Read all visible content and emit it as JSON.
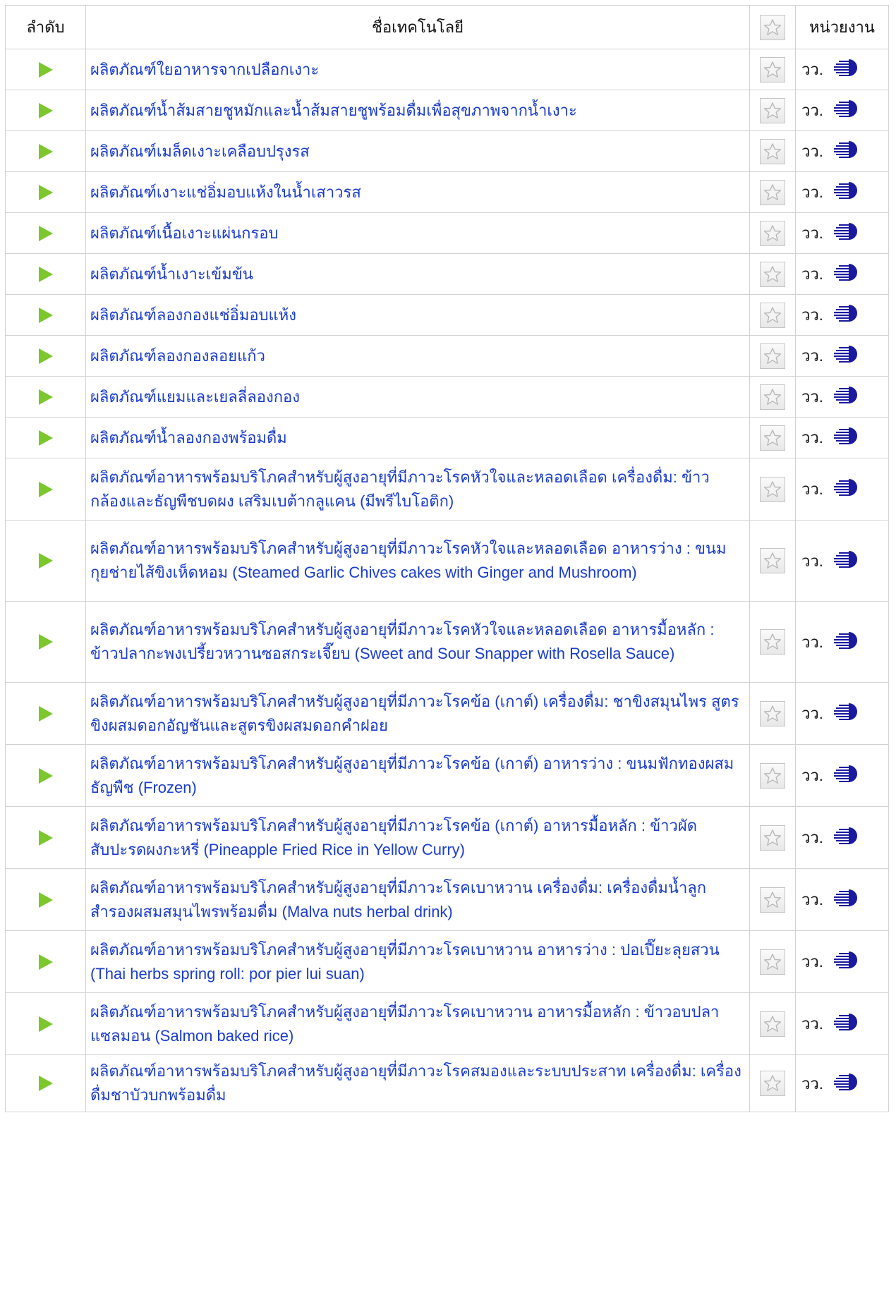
{
  "header": {
    "seq": "ลำดับ",
    "name": "ชื่อเทคโนโลยี",
    "fav_icon": "star-outline-icon",
    "unit": "หน่วยงาน"
  },
  "colors": {
    "link": "#1a3ccd",
    "play": "#7bc72c",
    "logo": "#1a1aa0",
    "border": "#d2d2d2"
  },
  "rows": [
    {
      "name": "ผลิตภัณฑ์ใยอาหารจากเปลือกเงาะ",
      "unit": "วว."
    },
    {
      "name": "ผลิตภัณฑ์น้ำส้มสายชูหมักและน้ำส้มสายชูพร้อมดื่มเพื่อสุขภาพจากน้ำเงาะ",
      "unit": "วว."
    },
    {
      "name": "ผลิตภัณฑ์เมล็ดเงาะเคลือบปรุงรส",
      "unit": "วว."
    },
    {
      "name": "ผลิตภัณฑ์เงาะแช่อิ่มอบแห้งในน้ำเสาวรส",
      "unit": "วว."
    },
    {
      "name": "ผลิตภัณฑ์เนื้อเงาะแผ่นกรอบ",
      "unit": "วว."
    },
    {
      "name": "ผลิตภัณฑ์น้ำเงาะเข้มข้น",
      "unit": "วว."
    },
    {
      "name": "ผลิตภัณฑ์ลองกองแช่อิ่มอบแห้ง",
      "unit": "วว."
    },
    {
      "name": "ผลิตภัณฑ์ลองกองลอยแก้ว",
      "unit": "วว."
    },
    {
      "name": "ผลิตภัณฑ์แยมและเยลลี่ลองกอง",
      "unit": "วว."
    },
    {
      "name": "ผลิตภัณฑ์น้ำลองกองพร้อมดื่ม",
      "unit": "วว."
    },
    {
      "name": "ผลิตภัณฑ์อาหารพร้อมบริโภคสำหรับผู้สูงอายุที่มีภาวะโรคหัวใจและหลอดเลือด เครื่องดื่ม: ข้าวกล้องและธัญพืชบดผง เสริมเบต้ากลูแคน (มีพรีไบโอติก)",
      "unit": "วว."
    },
    {
      "name": "ผลิตภัณฑ์อาหารพร้อมบริโภคสำหรับผู้สูงอายุที่มีภาวะโรคหัวใจและหลอดเลือด อาหารว่าง : ขนมกุยช่ายไส้ขิงเห็ดหอม (Steamed Garlic Chives cakes with Ginger and Mushroom)",
      "unit": "วว."
    },
    {
      "name": "ผลิตภัณฑ์อาหารพร้อมบริโภคสำหรับผู้สูงอายุที่มีภาวะโรคหัวใจและหลอดเลือด อาหารมื้อหลัก : ข้าวปลากะพงเปรี้ยวหวานซอสกระเจี๊ยบ (Sweet and Sour Snapper with Rosella Sauce)",
      "unit": "วว."
    },
    {
      "name": "ผลิตภัณฑ์อาหารพร้อมบริโภคสำหรับผู้สูงอายุที่มีภาวะโรคข้อ (เกาต์) เครื่องดื่ม: ชาขิงสมุนไพร สูตรขิงผสมดอกอัญชันและสูตรขิงผสมดอกคำฝอย",
      "unit": "วว."
    },
    {
      "name": "ผลิตภัณฑ์อาหารพร้อมบริโภคสำหรับผู้สูงอายุที่มีภาวะโรคข้อ (เกาต์) อาหารว่าง : ขนมฟักทองผสมธัญพืช (Frozen)",
      "unit": "วว."
    },
    {
      "name": "ผลิตภัณฑ์อาหารพร้อมบริโภคสำหรับผู้สูงอายุที่มีภาวะโรคข้อ (เกาต์) อาหารมื้อหลัก : ข้าวผัดสับปะรดผงกะหรี่ (Pineapple Fried Rice in Yellow Curry)",
      "unit": "วว."
    },
    {
      "name": "ผลิตภัณฑ์อาหารพร้อมบริโภคสำหรับผู้สูงอายุที่มีภาวะโรคเบาหวาน เครื่องดื่ม: เครื่องดื่มน้ำลูกสำรองผสมสมุนไพรพร้อมดื่ม (Malva nuts herbal drink)",
      "unit": "วว."
    },
    {
      "name": "ผลิตภัณฑ์อาหารพร้อมบริโภคสำหรับผู้สูงอายุที่มีภาวะโรคเบาหวาน อาหารว่าง : ปอเปี๊ยะลุยสวน (Thai herbs spring roll: por pier lui suan)",
      "unit": "วว."
    },
    {
      "name": "ผลิตภัณฑ์อาหารพร้อมบริโภคสำหรับผู้สูงอายุที่มีภาวะโรคเบาหวาน อาหารมื้อหลัก : ข้าวอบปลาแซลมอน (Salmon baked rice)",
      "unit": "วว."
    },
    {
      "name": "ผลิตภัณฑ์อาหารพร้อมบริโภคสำหรับผู้สูงอายุที่มีภาวะโรคสมองและระบบประสาท เครื่องดื่ม: เครื่องดื่มชาบัวบกพร้อมดื่ม",
      "unit": "วว."
    }
  ]
}
